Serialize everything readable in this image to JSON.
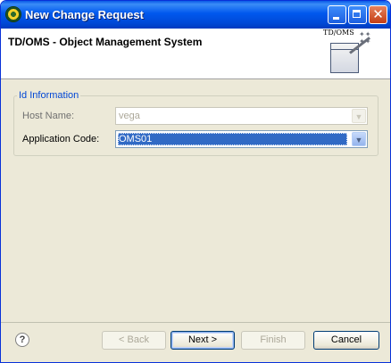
{
  "window": {
    "title": "New Change Request"
  },
  "header": {
    "title": "TD/OMS - Object Management System",
    "banner_label": "TD/OMS"
  },
  "group": {
    "title": "Id Information",
    "host_label": "Host Name:",
    "host_value": "vega",
    "app_label": "Application Code:",
    "app_value": "OMS01"
  },
  "buttons": {
    "back": "< Back",
    "next": "Next >",
    "finish": "Finish",
    "cancel": "Cancel",
    "help": "?"
  },
  "icons": {
    "title_icon": "app-logo-icon",
    "minimize": "minimize-icon",
    "maximize": "maximize-icon",
    "close": "close-icon",
    "dropdown": "chevron-down-icon",
    "help": "help-icon",
    "banner": "wizard-wand-icon"
  }
}
